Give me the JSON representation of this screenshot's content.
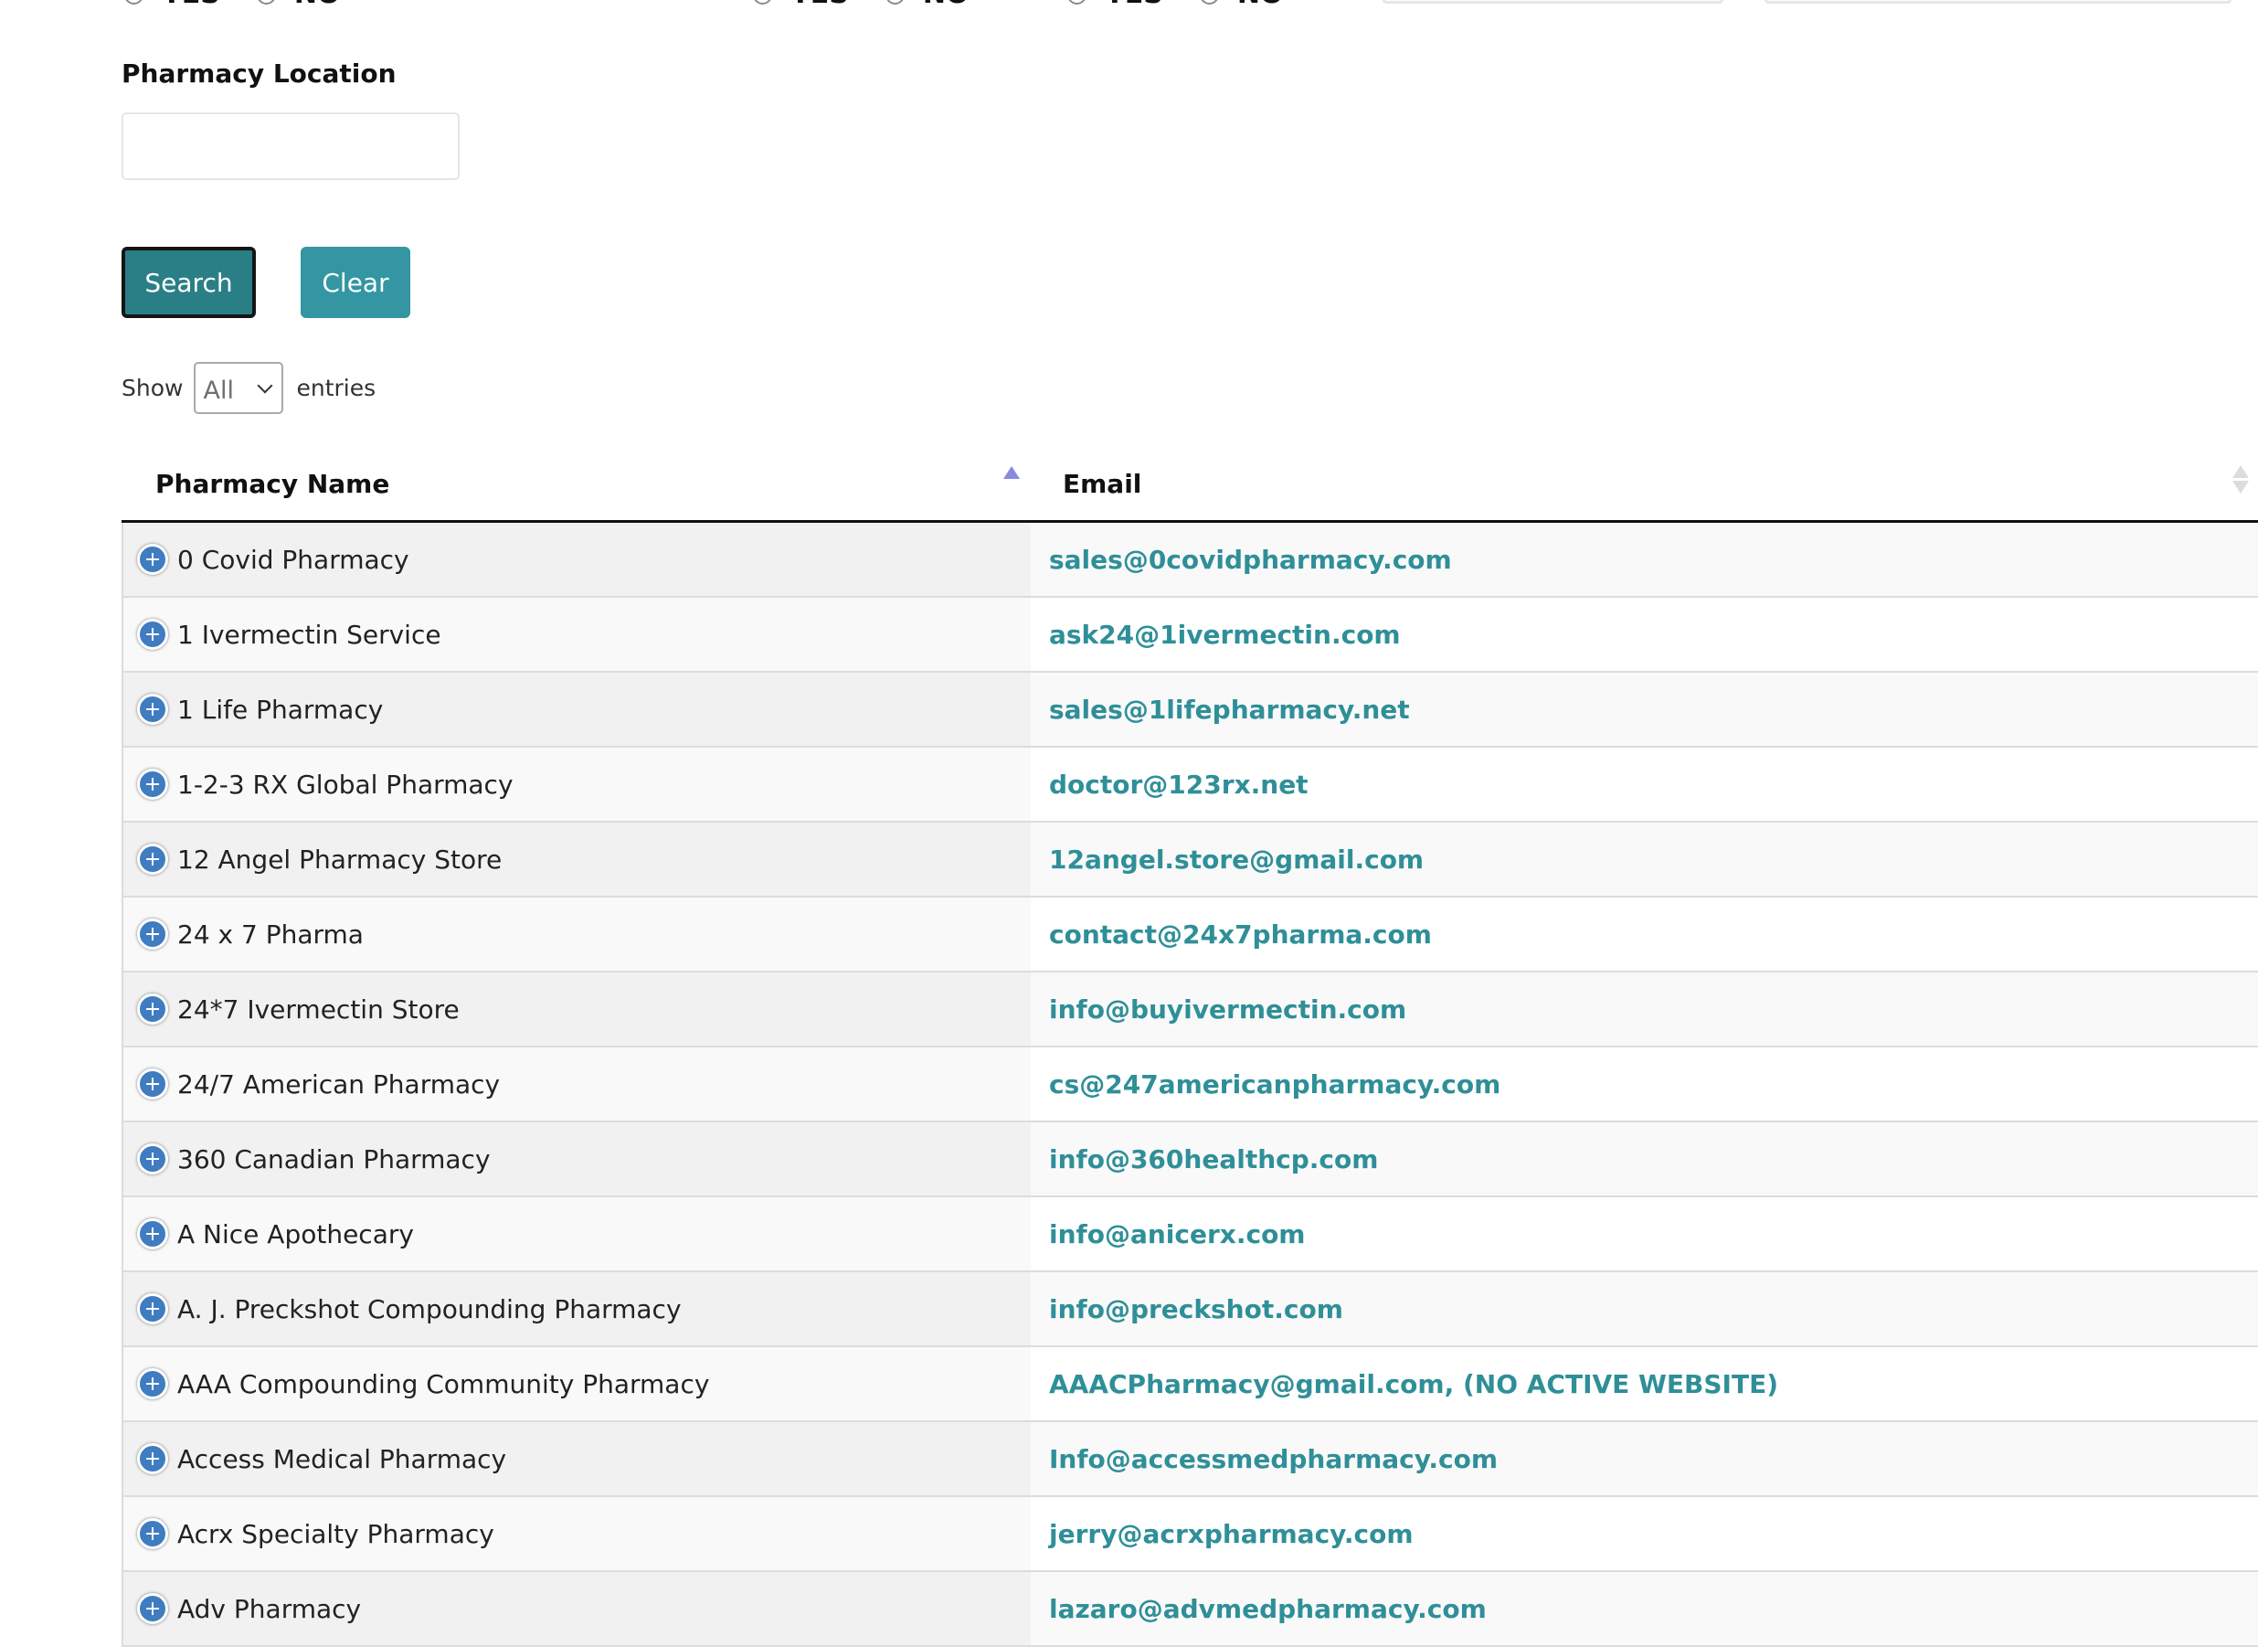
{
  "filters": {
    "radio_groups": [
      {
        "options": [
          "YES",
          "NO"
        ]
      },
      {
        "options": [
          "YES",
          "NO"
        ]
      },
      {
        "options": [
          "YES",
          "NO"
        ]
      }
    ],
    "pharmacy_location": {
      "label": "Pharmacy Location",
      "value": "",
      "placeholder": ""
    },
    "search_label": "Search",
    "clear_label": "Clear"
  },
  "length_control": {
    "show_label": "Show",
    "selected": "All",
    "entries_label": "entries"
  },
  "table": {
    "columns": [
      {
        "label": "Pharmacy Name",
        "sort": "ascending"
      },
      {
        "label": "Email",
        "sort": "none"
      }
    ],
    "rows": [
      {
        "name": "0 Covid Pharmacy",
        "email": "sales@0covidpharmacy.com"
      },
      {
        "name": "1 Ivermectin Service",
        "email": "ask24@1ivermectin.com"
      },
      {
        "name": "1 Life Pharmacy",
        "email": "sales@1lifepharmacy.net"
      },
      {
        "name": "1-2-3 RX Global Pharmacy",
        "email": "doctor@123rx.net"
      },
      {
        "name": "12 Angel Pharmacy Store",
        "email": "12angel.store@gmail.com"
      },
      {
        "name": "24 x 7 Pharma",
        "email": "contact@24x7pharma.com"
      },
      {
        "name": "24*7 Ivermectin Store",
        "email": "info@buyivermectin.com"
      },
      {
        "name": "24/7 American Pharmacy",
        "email": "cs@247americanpharmacy.com"
      },
      {
        "name": "360 Canadian Pharmacy",
        "email": "info@360healthcp.com"
      },
      {
        "name": "A Nice Apothecary",
        "email": "info@anicerx.com"
      },
      {
        "name": "A. J. Preckshot Compounding Pharmacy",
        "email": "info@preckshot.com"
      },
      {
        "name": "AAA Compounding Community Pharmacy",
        "email": "AAACPharmacy@gmail.com, (NO ACTIVE WEBSITE)"
      },
      {
        "name": "Access Medical Pharmacy",
        "email": "Info@accessmedpharmacy.com"
      },
      {
        "name": "Acrx Specialty Pharmacy",
        "email": "jerry@acrxpharmacy.com"
      },
      {
        "name": "Adv Pharmacy",
        "email": "lazaro@advmedpharmacy.com"
      }
    ]
  },
  "colors": {
    "search_button": "#2a7f87",
    "clear_button": "#3396a2",
    "email_link": "#2f8f98",
    "expand_icon": "#3f7cc0",
    "sort_active": "#8a8ae0"
  }
}
